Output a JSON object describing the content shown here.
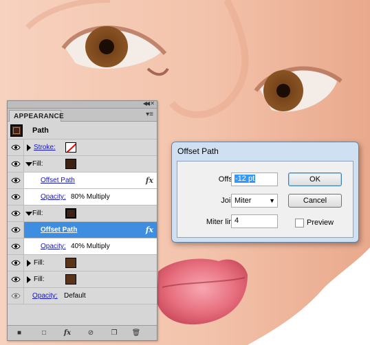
{
  "appearance_panel": {
    "tab": "APPEARANCE",
    "header": {
      "title": "Path"
    },
    "rows": [
      {
        "kind": "Stroke",
        "label": "Stroke:"
      },
      {
        "kind": "Fill",
        "label": "Fill:"
      },
      {
        "kind": "effect",
        "label": "Offset Path"
      },
      {
        "kind": "opacity",
        "label": "Opacity:",
        "value": "80% Multiply"
      },
      {
        "kind": "Fill",
        "label": "Fill:"
      },
      {
        "kind": "effect",
        "label": "Offset Path",
        "selected": true
      },
      {
        "kind": "opacity",
        "label": "Opacity:",
        "value": "40% Multiply"
      },
      {
        "kind": "Fill",
        "label": "Fill:"
      },
      {
        "kind": "Fill",
        "label": "Fill:"
      },
      {
        "kind": "opacity",
        "label": "Opacity:",
        "value": "Default"
      }
    ],
    "fx_glyph": "fx",
    "colors": {
      "dark_brown": "#3b2215",
      "mid_brown": "#5a3418",
      "selection": "#3d8ee0",
      "link": "#1515c8"
    }
  },
  "offset_path_dialog": {
    "title": "Offset Path",
    "offset_label": "Offset:",
    "offset_value": "-12 pt",
    "joins_label": "Joins:",
    "joins_value": "Miter",
    "miter_label": "Miter limit:",
    "miter_value": "4",
    "ok_label": "OK",
    "cancel_label": "Cancel",
    "preview_label": "Preview",
    "preview_checked": false
  }
}
